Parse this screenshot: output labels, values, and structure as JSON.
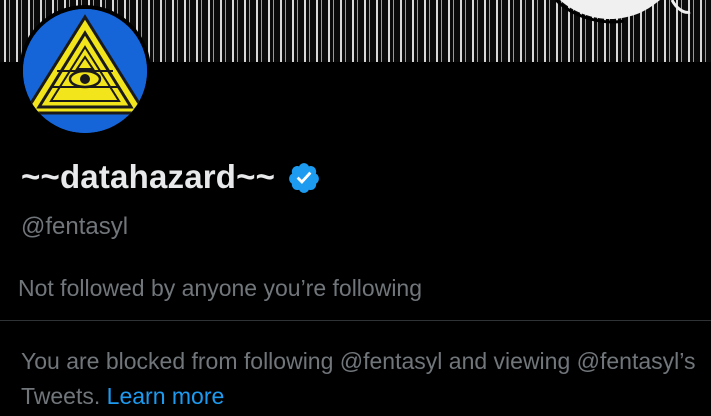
{
  "profile": {
    "display_name": "~~datahazard~~",
    "handle": "@fentasyl",
    "verified_icon": "verified-badge-icon",
    "followers_note": "Not followed by anyone you’re following"
  },
  "blocked_notice": {
    "text": "You are blocked from following @fentasyl and viewing @fentasyl’s Tweets.",
    "link_label": "Learn more"
  },
  "colors": {
    "background": "#000000",
    "primary_text": "#e7e9ea",
    "secondary_text": "#71767b",
    "link": "#1d9bf0",
    "verified_badge": "#1d9bf0",
    "avatar_blue": "#1565d8",
    "avatar_yellow": "#f2e51c"
  }
}
